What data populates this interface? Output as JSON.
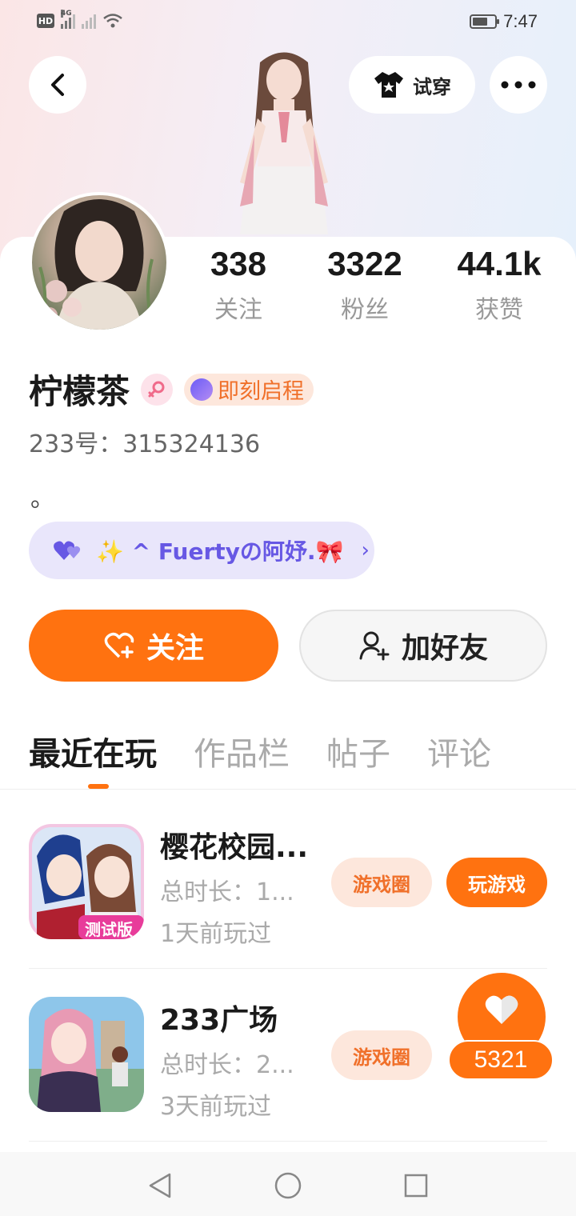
{
  "status_bar": {
    "time": "7:47",
    "network": "4G",
    "hd": "HD"
  },
  "header": {
    "try_on_label": "试穿"
  },
  "profile": {
    "stats": [
      {
        "value": "338",
        "label": "关注"
      },
      {
        "value": "3322",
        "label": "粉丝"
      },
      {
        "value": "44.1k",
        "label": "获赞"
      }
    ],
    "name": "柠檬茶",
    "level_badge_label": "即刻启程",
    "uid": "233号：315324136",
    "bio": "。",
    "family_label": "✨ ^ Fuertyの阿妤.🎀"
  },
  "actions": {
    "follow_label": "关注",
    "add_friend_label": "加好友"
  },
  "tabs": [
    {
      "label": "最近在玩",
      "active": true
    },
    {
      "label": "作品栏",
      "active": false
    },
    {
      "label": "帖子",
      "active": false
    },
    {
      "label": "评论",
      "active": false
    }
  ],
  "games": [
    {
      "title": "樱花校园...",
      "duration": "总时长：1...",
      "last_played": "1天前玩过",
      "circle_label": "游戏圈",
      "play_label": "玩游戏",
      "icon_badge": "测试版"
    },
    {
      "title": "233广场",
      "duration": "总时长：2...",
      "last_played": "3天前玩过",
      "circle_label": "游戏圈"
    }
  ],
  "like_fab": {
    "count": "5321"
  },
  "colors": {
    "accent": "#ff7210",
    "purple": "#6758e4",
    "accent_light": "#fde7dc"
  }
}
